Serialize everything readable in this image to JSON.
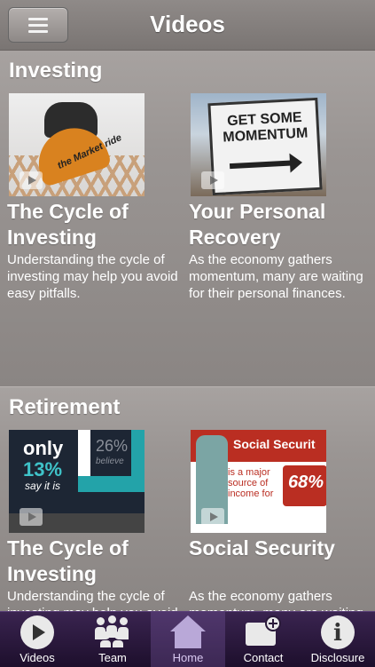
{
  "header": {
    "title": "Videos",
    "menu_icon": "hamburger-menu-icon"
  },
  "sections": [
    {
      "title": "Investing",
      "videos": [
        {
          "title": "The Cycle of Investing",
          "description": "Understanding the cycle of investing may help you avoid easy pitfalls.",
          "thumb_text": [
            "the",
            "Market",
            "ride"
          ]
        },
        {
          "title": "Your Personal Recovery",
          "description": "As the economy gathers momentum, many are waiting for their personal finances.",
          "thumb_text": [
            "GET SOME MOMENTUM"
          ]
        }
      ]
    },
    {
      "title": "Retirement",
      "videos": [
        {
          "title": "The Cycle of Investing",
          "description": "Understanding the cycle of investing may help you avoid easy pitfalls.",
          "thumb_text": [
            "only",
            "13%",
            "say it is",
            "26%",
            "believe"
          ]
        },
        {
          "title": "Social Security",
          "description": "As the economy gathers momentum, many are waiting for their personal finances.",
          "thumb_text": [
            "Social Securit",
            "is a major source of income for",
            "68%"
          ]
        }
      ]
    }
  ],
  "tabbar": {
    "active": "Home",
    "tabs": [
      {
        "label": "Videos",
        "icon": "play-circle-icon"
      },
      {
        "label": "Team",
        "icon": "team-icon"
      },
      {
        "label": "Home",
        "icon": "home-icon"
      },
      {
        "label": "Contact",
        "icon": "contact-add-icon"
      },
      {
        "label": "Disclosure",
        "icon": "info-icon"
      }
    ]
  },
  "colors": {
    "tabbar": "#2a1a3a",
    "active_tab": "#b9a8d8",
    "background": "#9a9593"
  }
}
